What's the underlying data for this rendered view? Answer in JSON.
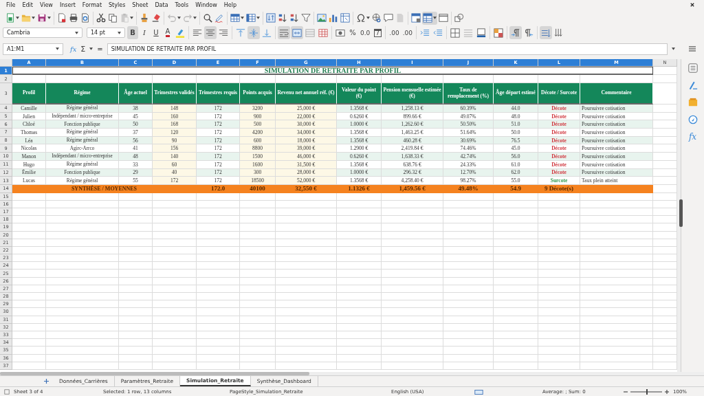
{
  "menu": [
    {
      "label": "File"
    },
    {
      "label": "Edit"
    },
    {
      "label": "View"
    },
    {
      "label": "Insert"
    },
    {
      "label": "Format"
    },
    {
      "label": "Styles"
    },
    {
      "label": "Sheet"
    },
    {
      "label": "Data"
    },
    {
      "label": "Tools"
    },
    {
      "label": "Window"
    },
    {
      "label": "Help"
    }
  ],
  "standard_toolbar": [
    [
      {
        "kind": "new",
        "pressed": false,
        "disabled": false
      },
      {
        "kind": "open",
        "pressed": false,
        "disabled": false
      },
      {
        "kind": "save",
        "pressed": false,
        "disabled": false
      }
    ],
    [
      {
        "kind": "pdf",
        "pressed": false,
        "disabled": false
      },
      {
        "kind": "print",
        "pressed": false,
        "disabled": false
      },
      {
        "kind": "preview",
        "pressed": false,
        "disabled": false
      }
    ],
    [
      {
        "kind": "cut",
        "pressed": false,
        "disabled": false
      },
      {
        "kind": "copy",
        "pressed": false,
        "disabled": false
      },
      {
        "kind": "paste",
        "pressed": false,
        "disabled": true
      }
    ],
    [
      {
        "kind": "clone",
        "pressed": false,
        "disabled": false
      },
      {
        "kind": "clear",
        "pressed": false,
        "disabled": false
      }
    ],
    [
      {
        "kind": "undo",
        "pressed": false,
        "disabled": true
      },
      {
        "kind": "redo",
        "pressed": false,
        "disabled": true
      }
    ],
    [
      {
        "kind": "find",
        "pressed": false,
        "disabled": false
      },
      {
        "kind": "spell",
        "pressed": false,
        "disabled": false
      }
    ],
    [
      {
        "kind": "row",
        "pressed": false,
        "disabled": false
      },
      {
        "kind": "column",
        "pressed": false,
        "disabled": false
      }
    ],
    [
      {
        "kind": "sort",
        "pressed": false,
        "disabled": false
      },
      {
        "kind": "asc",
        "pressed": false,
        "disabled": false
      },
      {
        "kind": "desc",
        "pressed": false,
        "disabled": false
      },
      {
        "kind": "filter",
        "pressed": false,
        "disabled": false
      }
    ],
    [
      {
        "kind": "image",
        "pressed": false,
        "disabled": false
      },
      {
        "kind": "chart",
        "pressed": false,
        "disabled": false
      },
      {
        "kind": "pivot",
        "pressed": false,
        "disabled": false
      }
    ],
    [
      {
        "kind": "special",
        "pressed": false,
        "disabled": false
      },
      {
        "kind": "hyperlink",
        "pressed": false,
        "disabled": false
      },
      {
        "kind": "comment",
        "pressed": false,
        "disabled": false
      },
      {
        "kind": "headerfooter",
        "pressed": false,
        "disabled": true
      }
    ],
    [
      {
        "kind": "printarea",
        "pressed": false,
        "disabled": false
      },
      {
        "kind": "freeze",
        "pressed": true,
        "disabled": false
      },
      {
        "kind": "split",
        "pressed": false,
        "disabled": false
      }
    ],
    [
      {
        "kind": "shapes",
        "pressed": false,
        "disabled": false
      }
    ]
  ],
  "format_toolbar": {
    "font_name": "Cambria",
    "font_size": "14 pt",
    "groups": [
      [
        {
          "kind": "bold",
          "label": "B",
          "pressed": true
        },
        {
          "kind": "italic",
          "label": "I",
          "pressed": false
        },
        {
          "kind": "underline",
          "label": "U",
          "pressed": false
        },
        {
          "kind": "fontcolor",
          "label": "A",
          "pressed": false
        },
        {
          "kind": "highlight",
          "pressed": false
        }
      ],
      [
        {
          "kind": "alignleft",
          "pressed": false
        },
        {
          "kind": "aligncenter",
          "pressed": true
        },
        {
          "kind": "alignright",
          "pressed": false
        }
      ],
      [
        {
          "kind": "aligntop",
          "pressed": false
        },
        {
          "kind": "alignmiddle",
          "pressed": true
        },
        {
          "kind": "alignbottom",
          "pressed": false
        }
      ],
      [
        {
          "kind": "wrap",
          "pressed": true
        },
        {
          "kind": "mergecenter",
          "pressed": true
        },
        {
          "kind": "merge",
          "pressed": false
        },
        {
          "kind": "unmerge",
          "pressed": false
        }
      ],
      [
        {
          "kind": "currency",
          "pressed": false
        },
        {
          "kind": "percent",
          "label": "%",
          "pressed": false
        },
        {
          "kind": "number",
          "label": "0.0",
          "pressed": false
        },
        {
          "kind": "date",
          "label": "7",
          "pressed": false
        }
      ],
      [
        {
          "kind": "adddecimal",
          "label": ".00",
          "pressed": false
        },
        {
          "kind": "deldecimal",
          "label": ".00",
          "pressed": false
        }
      ],
      [
        {
          "kind": "indent",
          "pressed": false
        },
        {
          "kind": "outdent",
          "pressed": false
        }
      ],
      [
        {
          "kind": "borders",
          "pressed": false
        },
        {
          "kind": "borderstyle",
          "pressed": false
        },
        {
          "kind": "bordercolor",
          "pressed": false
        }
      ],
      [
        {
          "kind": "conditional",
          "pressed": false
        }
      ],
      [
        {
          "kind": "ltr",
          "pressed": true
        },
        {
          "kind": "rtl",
          "pressed": false
        }
      ],
      [
        {
          "kind": "textltr",
          "pressed": true
        },
        {
          "kind": "textttb",
          "pressed": false
        }
      ]
    ]
  },
  "formula_bar": {
    "cell_ref": "A1:M1",
    "function_wizard": "fx",
    "sum": "Σ",
    "equals": "=",
    "content": "SIMULATION DE RETRAITE PAR PROFIL"
  },
  "sheet": {
    "columns": [
      {
        "label": "A",
        "selected": true
      },
      {
        "label": "B",
        "selected": true
      },
      {
        "label": "C",
        "selected": true
      },
      {
        "label": "D",
        "selected": true
      },
      {
        "label": "E",
        "selected": true
      },
      {
        "label": "F",
        "selected": true
      },
      {
        "label": "G",
        "selected": true
      },
      {
        "label": "H",
        "selected": true
      },
      {
        "label": "I",
        "selected": true
      },
      {
        "label": "J",
        "selected": true
      },
      {
        "label": "K",
        "selected": true
      },
      {
        "label": "L",
        "selected": true
      },
      {
        "label": "M",
        "selected": true
      },
      {
        "label": "N",
        "selected": false
      }
    ],
    "row_numbers": [
      {
        "label": "1",
        "selected": true
      },
      {
        "label": "2",
        "selected": false
      },
      {
        "label": "3",
        "selected": false
      },
      {
        "label": "4",
        "selected": false
      },
      {
        "label": "5",
        "selected": false
      },
      {
        "label": "6",
        "selected": false
      },
      {
        "label": "7",
        "selected": false
      },
      {
        "label": "8",
        "selected": false
      },
      {
        "label": "9",
        "selected": false
      },
      {
        "label": "10",
        "selected": false
      },
      {
        "label": "11",
        "selected": false
      },
      {
        "label": "12",
        "selected": false
      },
      {
        "label": "13",
        "selected": false
      },
      {
        "label": "14",
        "selected": false
      },
      {
        "label": "15",
        "selected": false
      },
      {
        "label": "16",
        "selected": false
      },
      {
        "label": "17",
        "selected": false
      },
      {
        "label": "18",
        "selected": false
      },
      {
        "label": "19",
        "selected": false
      },
      {
        "label": "20",
        "selected": false
      },
      {
        "label": "21",
        "selected": false
      },
      {
        "label": "22",
        "selected": false
      },
      {
        "label": "23",
        "selected": false
      },
      {
        "label": "24",
        "selected": false
      },
      {
        "label": "25",
        "selected": false
      },
      {
        "label": "26",
        "selected": false
      },
      {
        "label": "27",
        "selected": false
      },
      {
        "label": "28",
        "selected": false
      },
      {
        "label": "29",
        "selected": false
      },
      {
        "label": "30",
        "selected": false
      },
      {
        "label": "31",
        "selected": false
      },
      {
        "label": "32",
        "selected": false
      },
      {
        "label": "33",
        "selected": false
      },
      {
        "label": "34",
        "selected": false
      },
      {
        "label": "35",
        "selected": false
      },
      {
        "label": "36",
        "selected": false
      },
      {
        "label": "37",
        "selected": false
      }
    ],
    "title": "SIMULATION DE RETRAITE PAR PROFIL",
    "headers": [
      "Profil",
      "Régime",
      "Âge actuel",
      "Trimestres validés",
      "Trimestres requis",
      "Points acquis",
      "Revenu net annuel réf. (€)",
      "Valeur du point (€)",
      "Pension mensuelle estimée (€)",
      "Taux de remplacement (%)",
      "Âge départ estimé",
      "Décote / Surcote",
      "Commentaire"
    ],
    "rows": [
      {
        "cells": [
          "Camille",
          "Régime général",
          "38",
          "148",
          "172",
          "3200",
          "25,000 €",
          "1.3568 €",
          "1,258.13 €",
          "60.39%",
          "44.0"
        ],
        "adjustment": "Décote",
        "color": "#d0343c",
        "comment": "Poursuivre cotisation"
      },
      {
        "cells": [
          "Julien",
          "Indépendant / micro-entreprise",
          "45",
          "160",
          "172",
          "900",
          "22,000 €",
          "0.6260 €",
          "899.66 €",
          "49.07%",
          "48.0"
        ],
        "adjustment": "Décote",
        "color": "#d0343c",
        "comment": "Poursuivre cotisation"
      },
      {
        "cells": [
          "Chloé",
          "Fonction publique",
          "50",
          "168",
          "172",
          "500",
          "30,000 €",
          "1.0000 €",
          "1,262.60 €",
          "50.50%",
          "51.0"
        ],
        "adjustment": "Décote",
        "color": "#d0343c",
        "comment": "Poursuivre cotisation"
      },
      {
        "cells": [
          "Thomas",
          "Régime général",
          "37",
          "120",
          "172",
          "4200",
          "34,000 €",
          "1.3568 €",
          "1,463.25 €",
          "51.64%",
          "50.0"
        ],
        "adjustment": "Décote",
        "color": "#d0343c",
        "comment": "Poursuivre cotisation"
      },
      {
        "cells": [
          "Léa",
          "Régime général",
          "56",
          "90",
          "172",
          "600",
          "18,000 €",
          "1.3568 €",
          "460.28 €",
          "30.69%",
          "76.5"
        ],
        "adjustment": "Décote",
        "color": "#d0343c",
        "comment": "Poursuivre cotisation"
      },
      {
        "cells": [
          "Nicolas",
          "Agirc-Arrco",
          "41",
          "156",
          "172",
          "8800",
          "39,000 €",
          "1.2900 €",
          "2,419.84 €",
          "74.46%",
          "45.0"
        ],
        "adjustment": "Décote",
        "color": "#d0343c",
        "comment": "Poursuivre cotisation"
      },
      {
        "cells": [
          "Manon",
          "Indépendant / micro-entreprise",
          "48",
          "140",
          "172",
          "1500",
          "46,000 €",
          "0.6260 €",
          "1,638.33 €",
          "42.74%",
          "56.0"
        ],
        "adjustment": "Décote",
        "color": "#d0343c",
        "comment": "Poursuivre cotisation"
      },
      {
        "cells": [
          "Hugo",
          "Régime général",
          "33",
          "60",
          "172",
          "1600",
          "31,500 €",
          "1.3568 €",
          "638.76 €",
          "24.33%",
          "61.0"
        ],
        "adjustment": "Décote",
        "color": "#d0343c",
        "comment": "Poursuivre cotisation"
      },
      {
        "cells": [
          "Émilie",
          "Fonction publique",
          "29",
          "40",
          "172",
          "300",
          "28,000 €",
          "1.0000 €",
          "296.32 €",
          "12.70%",
          "62.0"
        ],
        "adjustment": "Décote",
        "color": "#d0343c",
        "comment": "Poursuivre cotisation"
      },
      {
        "cells": [
          "Lucas",
          "Régime général",
          "55",
          "172",
          "172",
          "18500",
          "52,000 €",
          "1.3568 €",
          "4,258.40 €",
          "98.27%",
          "55.0"
        ],
        "adjustment": "Surcote",
        "color": "#2e9a4e",
        "comment": "Taux plein atteint"
      }
    ],
    "summary": {
      "label": "SYNTHÈSE / MOYENNES",
      "values": [
        "172.0",
        "40100",
        "32,550 €",
        "1.1326 €",
        "1,459.56 €",
        "49.48%",
        "54.9",
        "9 Décote(s)"
      ]
    }
  },
  "sidebar": [
    {
      "kind": "properties"
    },
    {
      "kind": "styles"
    },
    {
      "kind": "gallery"
    },
    {
      "kind": "navigator"
    },
    {
      "kind": "functions",
      "label": "fx"
    }
  ],
  "sheet_tabs": [
    {
      "label": "Données_Carrières",
      "selected": false
    },
    {
      "label": "Paramètres_Retraite",
      "selected": false
    },
    {
      "label": "Simulation_Retraite",
      "selected": true
    },
    {
      "label": "Synthèse_Dashboard",
      "selected": false
    }
  ],
  "status_bar": {
    "sheet": "Sheet 3 of 4",
    "selection": "Selected: 1 row, 13 columns",
    "page_style": "PageStyle_Simulation_Retraite",
    "language": "English (USA)",
    "summary": "Average: ; Sum: 0",
    "zoom_slider": {
      "level": 0.5
    },
    "zoom": "100%"
  }
}
